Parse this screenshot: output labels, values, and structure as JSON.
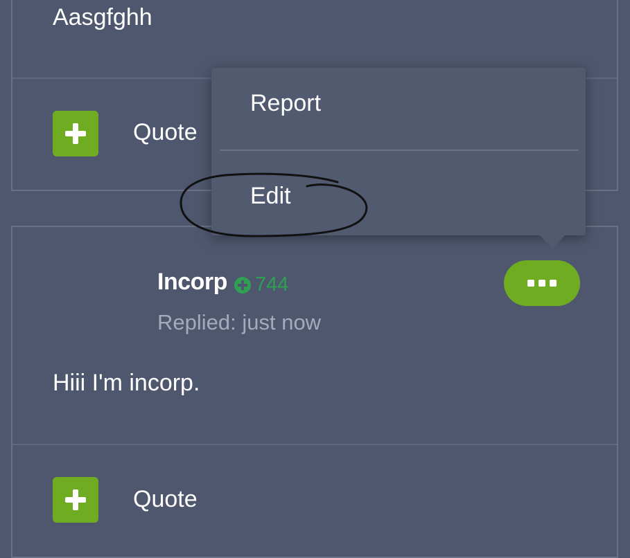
{
  "posts": [
    {
      "text": "Aasgfghh",
      "actions": {
        "quote_label": "Quote"
      }
    },
    {
      "author": "Incorp",
      "reputation": "744",
      "replied": "Replied: just now",
      "text": "Hiii  I'm incorp.",
      "actions": {
        "quote_label": "Quote"
      }
    }
  ],
  "menu": {
    "items": [
      "Report",
      "Edit"
    ]
  },
  "colors": {
    "background": "#4f576e",
    "accent_green": "#6fac22",
    "reputation_green": "#2f9f54",
    "muted_text": "#a5abbb"
  },
  "icons": {
    "quote": "plus-icon",
    "reputation": "plus-circle-icon",
    "more": "ellipsis-icon"
  }
}
